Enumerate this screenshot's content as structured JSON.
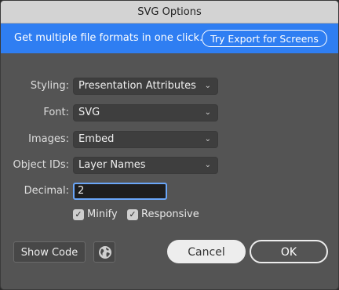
{
  "window": {
    "title": "SVG Options"
  },
  "banner": {
    "text": "Get multiple file formats in one click.",
    "button_label": "Try Export for Screens"
  },
  "form": {
    "styling": {
      "label": "Styling:",
      "value": "Presentation Attributes"
    },
    "font": {
      "label": "Font:",
      "value": "SVG"
    },
    "images": {
      "label": "Images:",
      "value": "Embed"
    },
    "object_ids": {
      "label": "Object IDs:",
      "value": "Layer Names"
    },
    "decimal": {
      "label": "Decimal:",
      "value": "2"
    },
    "minify": {
      "label": "Minify",
      "checked": true
    },
    "responsive": {
      "label": "Responsive",
      "checked": true
    }
  },
  "footer": {
    "show_code_label": "Show Code",
    "globe_icon": "globe-icon",
    "cancel_label": "Cancel",
    "ok_label": "OK"
  },
  "colors": {
    "dialog_bg": "#545454",
    "banner_bg": "#2f7ef2",
    "titlebar_bg": "#d3d3d3",
    "focus_ring": "#6aa6f8"
  }
}
